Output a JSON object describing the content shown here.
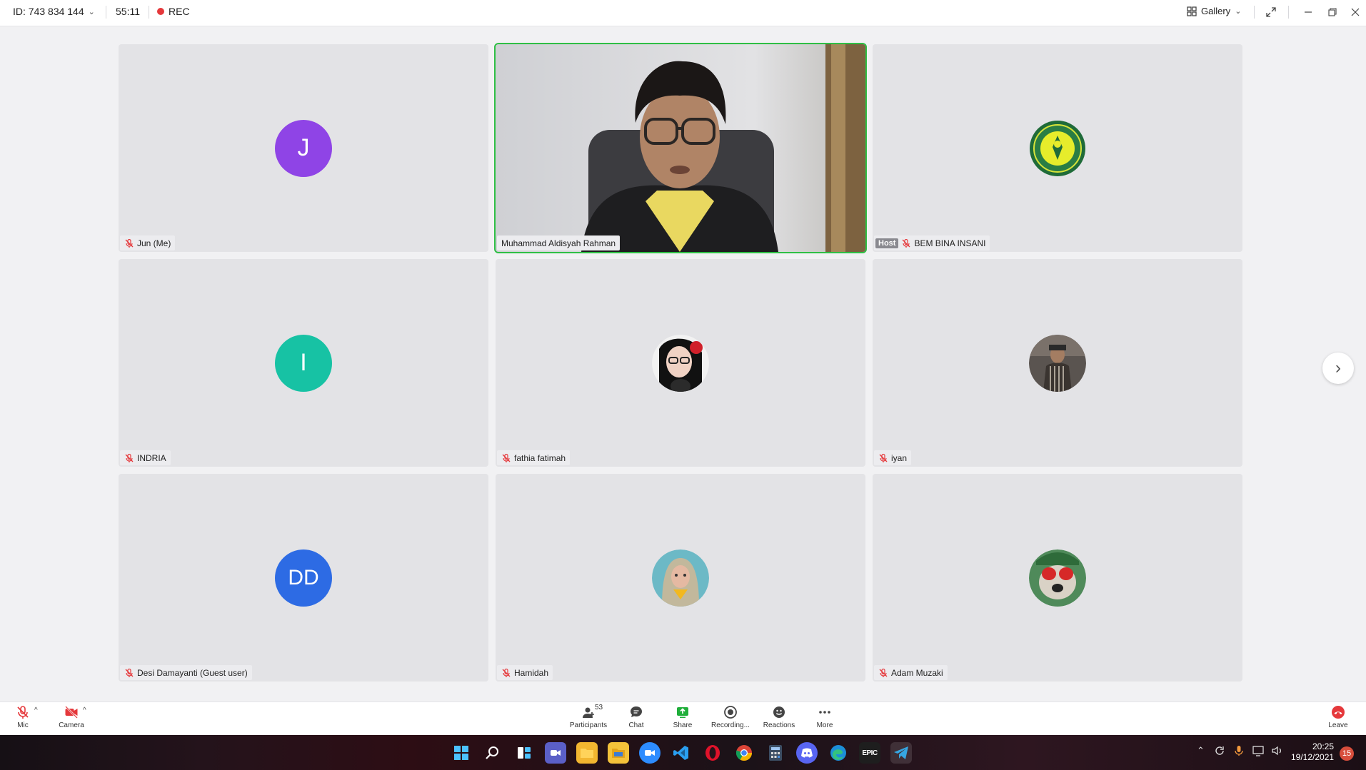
{
  "topbar": {
    "meeting_id": "ID: 743 834 144",
    "timer": "55:11",
    "rec_label": "REC",
    "view_label": "Gallery"
  },
  "tiles": [
    {
      "name": "Jun (Me)",
      "avatar_text": "J",
      "avatar_color": "#8f44e6",
      "muted": true,
      "host": false
    },
    {
      "name": "Muhammad Aldisyah Rahman",
      "video": true,
      "muted": false,
      "host": false,
      "active_speaker": true
    },
    {
      "name": "BEM BINA INSANI",
      "avatar_text": "",
      "avatar_kind": "logo",
      "muted": true,
      "host": true,
      "host_label": "Host"
    },
    {
      "name": "INDRIA",
      "avatar_text": "I",
      "avatar_color": "#17c2a4",
      "muted": true,
      "host": false
    },
    {
      "name": "fathia fatimah",
      "avatar_kind": "photo",
      "muted": true,
      "host": false
    },
    {
      "name": "iyan",
      "avatar_kind": "photo",
      "muted": true,
      "host": false
    },
    {
      "name": "Desi Damayanti (Guest user)",
      "avatar_text": "DD",
      "avatar_color": "#2d6be4",
      "muted": true,
      "host": false
    },
    {
      "name": "Hamidah",
      "avatar_kind": "photo",
      "muted": true,
      "host": false
    },
    {
      "name": "Adam Muzaki",
      "avatar_kind": "photo",
      "muted": true,
      "host": false
    }
  ],
  "toolbar": {
    "mic": "Mic",
    "camera": "Camera",
    "participants": "Participants",
    "participants_count": "53",
    "chat": "Chat",
    "share": "Share",
    "recording": "Recording...",
    "reactions": "Reactions",
    "more": "More",
    "leave": "Leave"
  },
  "taskbar": {
    "time": "20:25",
    "date": "19/12/2021",
    "notifications": "15",
    "epic_label": "EPIC"
  },
  "colors": {
    "active_speaker_border": "#2fbf45",
    "muted_red": "#e5383b",
    "share_green": "#1fae3a",
    "leave_red": "#e5383b"
  }
}
